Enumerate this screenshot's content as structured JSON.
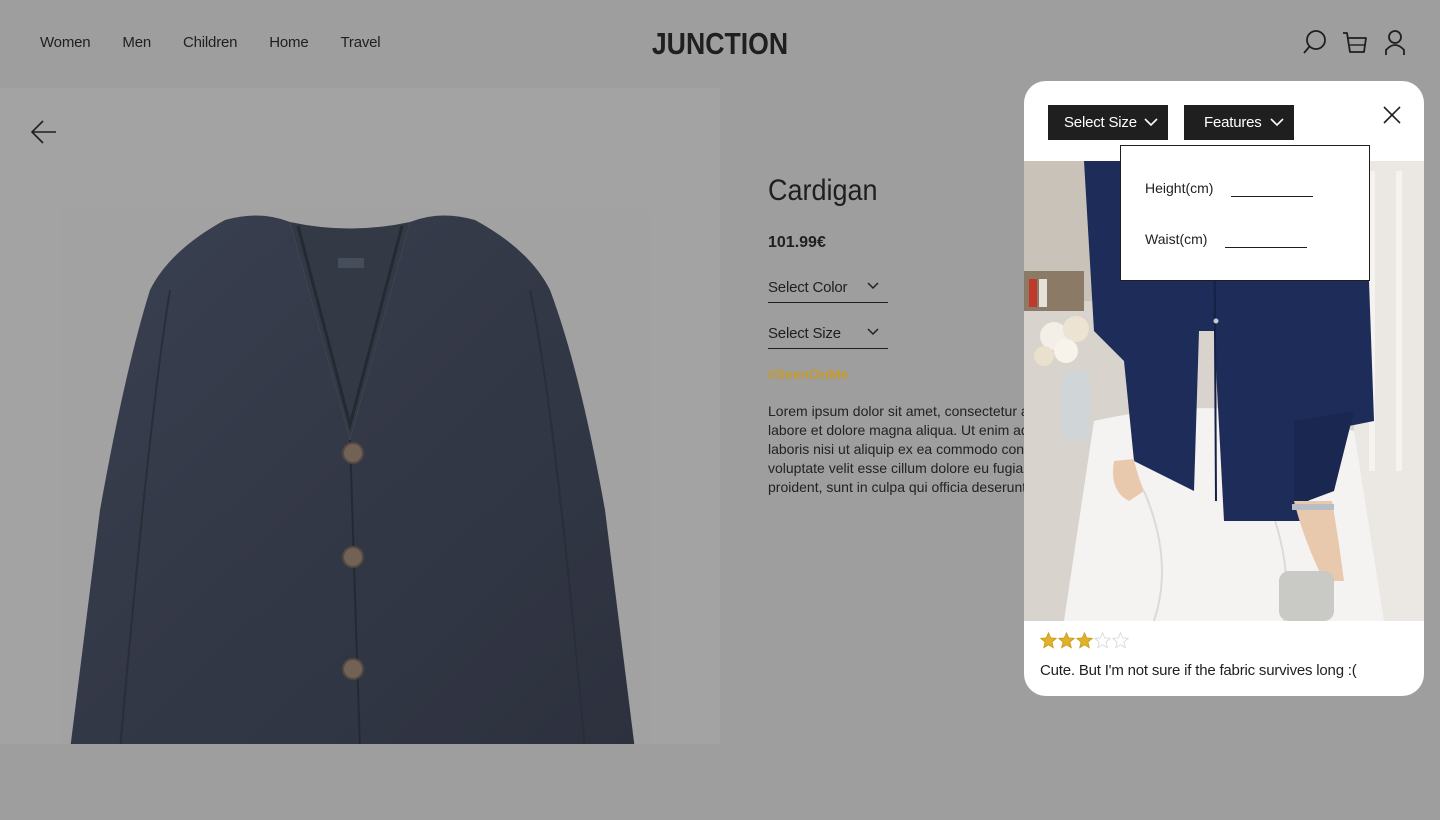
{
  "header": {
    "nav": [
      "Women",
      "Men",
      "Children",
      "Home",
      "Travel"
    ],
    "logo": "JUNCTION",
    "icons": [
      "search-icon",
      "cart-icon",
      "user-icon"
    ]
  },
  "product": {
    "title": "Cardigan",
    "price": "101.99€",
    "select_color": "Select Color",
    "select_size": "Select Size",
    "hashtag": "#SeenOnMe",
    "description_lines": [
      "Lorem ipsum dolor sit amet, consectetur a",
      "labore et dolore magna aliqua. Ut enim ad",
      "laboris nisi ut aliquip ex ea commodo con",
      "voluptate velit esse cillum dolore eu fugia",
      "proident, sunt in culpa qui officia deserunt"
    ]
  },
  "review_modal": {
    "select_size": "Select Size",
    "features": "Features",
    "features_popup": {
      "height_label": "Height(cm)",
      "height_value": "",
      "waist_label": "Waist(cm)",
      "waist_value": ""
    },
    "rating": 3,
    "rating_max": 5,
    "review_text": "Cute. But I'm not sure if the fabric survives long :("
  },
  "colors": {
    "overlay_gray": "#9e9e9e",
    "accent_hashtag": "#c79a2e",
    "star": "#e0b12a",
    "dark": "#1f1f1f"
  }
}
